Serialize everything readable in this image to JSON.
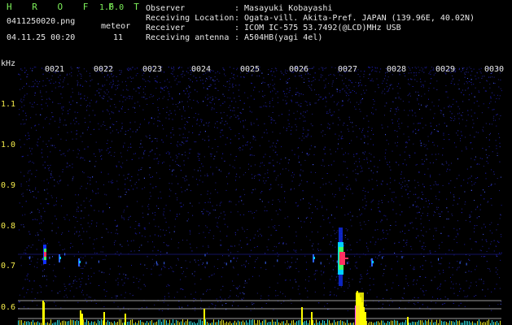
{
  "app": {
    "name": "H R O F F T",
    "version": "1.0.0"
  },
  "file": {
    "name": "0411250020.png",
    "datetime": "04.11.25 00:20"
  },
  "meteor": {
    "label": "meteor",
    "count": "11"
  },
  "info": [
    {
      "key": "Observer",
      "value": ": Masayuki Kobayashi"
    },
    {
      "key": "Receiving Location",
      "value": ": Ogata-vill. Akita-Pref. JAPAN (139.96E, 40.02N)"
    },
    {
      "key": "Receiver",
      "value": ": ICOM IC-575 53.7492(@LCD)MHz USB"
    },
    {
      "key": "Receiving antenna",
      "value": ": A504HB(yagi 4el)"
    }
  ],
  "axis": {
    "unit": "kHz",
    "y_ticks": [
      "1.1",
      "1.0",
      "0.9",
      "0.8",
      "0.7",
      "0.6"
    ],
    "x_ticks": [
      "0021",
      "0022",
      "0023",
      "0024",
      "0025",
      "0026",
      "0027",
      "0028",
      "0029",
      "0030"
    ]
  },
  "colors": {
    "bg": "#000000",
    "text_green": "#7df05a",
    "text_white": "#e9e9e9",
    "text_yellow": "#f2e94a",
    "noise": "#2020b0",
    "spike": "#ffff00"
  },
  "chart_data": {
    "type": "heatmap",
    "title": "",
    "xlabel": "",
    "ylabel": "kHz",
    "x_ticks": [
      "0021",
      "0022",
      "0023",
      "0024",
      "0025",
      "0026",
      "0027",
      "0028",
      "0029",
      "0030"
    ],
    "y_ticks": [
      1.1,
      1.0,
      0.9,
      0.8,
      0.7,
      0.6
    ],
    "ylim": [
      0.58,
      1.17
    ],
    "meteor_echoes": [
      {
        "minute": 21.0,
        "freq_khz": 0.73,
        "strength": "medium"
      },
      {
        "minute": 21.3,
        "freq_khz": 0.72,
        "strength": "weak"
      },
      {
        "minute": 21.7,
        "freq_khz": 0.71,
        "strength": "weak"
      },
      {
        "minute": 26.5,
        "freq_khz": 0.72,
        "strength": "weak"
      },
      {
        "minute": 27.05,
        "freq_khz": 0.72,
        "strength": "strong"
      },
      {
        "minute": 27.7,
        "freq_khz": 0.71,
        "strength": "weak"
      }
    ]
  }
}
